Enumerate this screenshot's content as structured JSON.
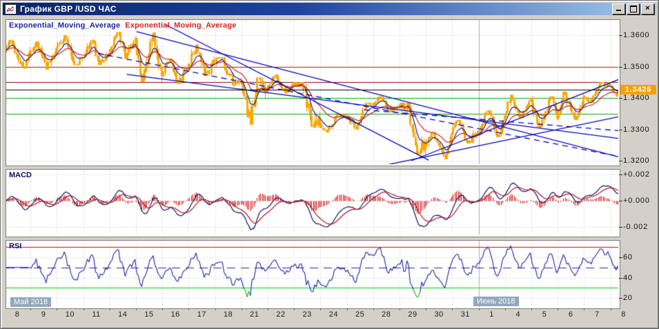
{
  "window": {
    "title": "График GBP /USD ЧАС",
    "buttons": {
      "minimize": "",
      "maximize": "",
      "close": "×"
    }
  },
  "colors": {
    "titlebar_left": "#0A246A",
    "titlebar_right": "#A6CAF0",
    "chrome": "#D4D0C8",
    "panel_bg": "#FFFFFF",
    "candle": "#FCA800",
    "candle_wick": "#E09600",
    "ema_fast": "#202080",
    "ema_slow": "#CC2222",
    "trendline": "#0000B8",
    "grid": "#C8C8C8",
    "badge_bg": "#F5A200",
    "macd_histogram": "#CC0000",
    "macd_line": "#101060",
    "macd_signal": "#B01020",
    "rsi_line": "#2020A0",
    "rsi_overbought": "#DD00BB",
    "rsi_oversold": "#00BB00",
    "month_tag_bg": "#92A8BE"
  },
  "main_chart": {
    "ema_label_1": {
      "text": "Exponential_Moving_Average",
      "color": "#2222AA"
    },
    "ema_label_2": {
      "text": "Exponential_Moving_Average",
      "color": "#DD2222"
    },
    "price_axis": {
      "labels": [
        {
          "text": "1.3600",
          "value": 1.36
        },
        {
          "text": "1.3500",
          "value": 1.35
        },
        {
          "text": "1.3400",
          "value": 1.34
        },
        {
          "text": "1.3300",
          "value": 1.33
        },
        {
          "text": "1.3200",
          "value": 1.32
        }
      ],
      "current": {
        "text": "1.3426",
        "value": 1.3426
      }
    }
  },
  "macd_panel": {
    "label": "MACD",
    "axis": [
      {
        "text": "+0.002",
        "value": 0.002
      },
      {
        "text": "+0.000",
        "value": 0.0
      },
      {
        "text": "-0.002",
        "value": -0.002
      }
    ]
  },
  "rsi_panel": {
    "label": "RSI",
    "axis": [
      {
        "text": "60",
        "value": 60
      },
      {
        "text": "40",
        "value": 40
      },
      {
        "text": "20",
        "value": 20
      }
    ],
    "levels": {
      "overbought": 70,
      "middle": 50,
      "oversold": 30
    }
  },
  "date_axis": {
    "month_left": "Май 2018",
    "month_right": "Июнь 2018",
    "days": [
      "8",
      "9",
      "10",
      "11",
      "14",
      "15",
      "16",
      "17",
      "18",
      "21",
      "22",
      "23",
      "24",
      "25",
      "28",
      "29",
      "30",
      "31",
      "1",
      "4",
      "5",
      "6",
      "7",
      "8"
    ]
  },
  "chart_data": {
    "type": "candlestick",
    "symbol": "GBP/USD",
    "timeframe": "1H",
    "title": "График GBP /USD ЧАС",
    "x_axis_days": [
      "8",
      "9",
      "10",
      "11",
      "14",
      "15",
      "16",
      "17",
      "18",
      "21",
      "22",
      "23",
      "24",
      "25",
      "28",
      "29",
      "30",
      "31",
      "1",
      "4",
      "5",
      "6",
      "7",
      "8"
    ],
    "months": [
      "Май 2018",
      "Июнь 2018"
    ],
    "june_start_index": 18,
    "price_axis": {
      "ticks": [
        1.36,
        1.35,
        1.34,
        1.33,
        1.32
      ],
      "range": [
        1.3195,
        1.365
      ],
      "current_price": 1.3426
    },
    "daily_ohlc": [
      {
        "day": "8",
        "ohlc": [
          1.3535,
          1.3585,
          1.3495,
          1.355
        ]
      },
      {
        "day": "9",
        "ohlc": [
          1.355,
          1.358,
          1.349,
          1.356
        ]
      },
      {
        "day": "10",
        "ohlc": [
          1.356,
          1.36,
          1.3505,
          1.353
        ]
      },
      {
        "day": "11",
        "ohlc": [
          1.353,
          1.3585,
          1.3505,
          1.3545
        ]
      },
      {
        "day": "14",
        "ohlc": [
          1.3545,
          1.361,
          1.3525,
          1.359
        ]
      },
      {
        "day": "15",
        "ohlc": [
          1.359,
          1.3608,
          1.345,
          1.347
        ]
      },
      {
        "day": "16",
        "ohlc": [
          1.347,
          1.3525,
          1.3445,
          1.35
        ]
      },
      {
        "day": "17",
        "ohlc": [
          1.35,
          1.357,
          1.347,
          1.3515
        ]
      },
      {
        "day": "18",
        "ohlc": [
          1.3515,
          1.353,
          1.344,
          1.3455
        ]
      },
      {
        "day": "21",
        "ohlc": [
          1.3455,
          1.3465,
          1.3315,
          1.3425
        ]
      },
      {
        "day": "22",
        "ohlc": [
          1.3425,
          1.3475,
          1.3415,
          1.344
        ]
      },
      {
        "day": "23",
        "ohlc": [
          1.344,
          1.345,
          1.3305,
          1.332
        ]
      },
      {
        "day": "24",
        "ohlc": [
          1.332,
          1.335,
          1.329,
          1.3335
        ]
      },
      {
        "day": "25",
        "ohlc": [
          1.3335,
          1.3385,
          1.33,
          1.338
        ]
      },
      {
        "day": "28",
        "ohlc": [
          1.338,
          1.3405,
          1.3355,
          1.3375
        ]
      },
      {
        "day": "29",
        "ohlc": [
          1.3375,
          1.3385,
          1.322,
          1.325
        ]
      },
      {
        "day": "30",
        "ohlc": [
          1.325,
          1.329,
          1.3205,
          1.3285
        ]
      },
      {
        "day": "31",
        "ohlc": [
          1.3285,
          1.333,
          1.3255,
          1.3295
        ]
      },
      {
        "day": "1",
        "ohlc": [
          1.3295,
          1.336,
          1.3275,
          1.3345
        ]
      },
      {
        "day": "4",
        "ohlc": [
          1.3345,
          1.341,
          1.3335,
          1.34
        ]
      },
      {
        "day": "5",
        "ohlc": [
          1.34,
          1.3405,
          1.3305,
          1.3335
        ]
      },
      {
        "day": "6",
        "ohlc": [
          1.3335,
          1.342,
          1.333,
          1.3405
        ]
      },
      {
        "day": "7",
        "ohlc": [
          1.3405,
          1.345,
          1.3385,
          1.344
        ]
      },
      {
        "day": "8",
        "ohlc": [
          1.344,
          1.3445,
          1.3405,
          1.3426
        ]
      }
    ],
    "overlays": {
      "emas": [
        {
          "name": "Exponential_Moving_Average",
          "period": 8,
          "color": "#202080"
        },
        {
          "name": "Exponential_Moving_Average",
          "period": 21,
          "color": "#CC2222"
        }
      ],
      "levels": [
        {
          "price": 1.35,
          "color": "#DE0000",
          "role": "resistance"
        },
        {
          "price": 1.345,
          "color": "#8B0000",
          "role": "resistance"
        },
        {
          "price": 1.34,
          "color": "#00AE00",
          "role": "support"
        },
        {
          "price": 1.335,
          "color": "#00AE00",
          "role": "support"
        },
        {
          "price": 1.3426,
          "color": "#000000",
          "role": "current_price"
        }
      ],
      "trendlines": [
        {
          "x1": 0.213,
          "p1": 1.3611,
          "x2": 1.005,
          "p2": 1.321,
          "style": "solid"
        },
        {
          "x1": 0.26,
          "p1": 1.3634,
          "x2": 0.69,
          "p2": 1.3202,
          "style": "solid"
        },
        {
          "x1": 0.197,
          "p1": 1.3475,
          "x2": 1.005,
          "p2": 1.327,
          "style": "solid"
        },
        {
          "x1": 0.662,
          "p1": 1.32,
          "x2": 1.005,
          "p2": 1.3462,
          "style": "solid"
        },
        {
          "x1": 0.6,
          "p1": 1.3178,
          "x2": 1.005,
          "p2": 1.3342,
          "style": "solid"
        },
        {
          "x1": 0.15,
          "p1": 1.3542,
          "x2": 1.005,
          "p2": 1.3212,
          "style": "dashed"
        },
        {
          "x1": 0.585,
          "p1": 1.3362,
          "x2": 1.005,
          "p2": 1.3295,
          "style": "dashed"
        }
      ]
    },
    "indicators": [
      {
        "name": "MACD",
        "fast": 12,
        "slow": 26,
        "signal": 9,
        "axis_ticks": [
          "+0.002",
          "+0.000",
          "-0.002"
        ],
        "axis_range": [
          -0.0025,
          0.0025
        ]
      },
      {
        "name": "RSI",
        "period": 14,
        "axis_ticks": [
          60,
          40,
          20
        ],
        "levels": [
          70,
          50,
          30
        ],
        "axis_range": [
          15,
          77
        ]
      }
    ],
    "legend_position": "top-left",
    "grid": true
  }
}
